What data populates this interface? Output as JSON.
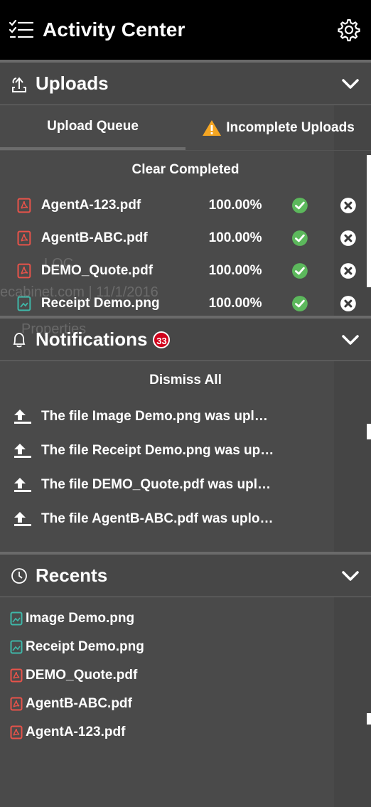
{
  "header": {
    "title": "Activity Center"
  },
  "uploads": {
    "title": "Uploads",
    "tabs": [
      {
        "label": "Upload Queue",
        "active": true
      },
      {
        "label": "Incomplete Uploads",
        "active": false
      }
    ],
    "clear_label": "Clear Completed",
    "items": [
      {
        "name": "AgentA-123.pdf",
        "progress": "100.00%",
        "type": "pdf"
      },
      {
        "name": "AgentB-ABC.pdf",
        "progress": "100.00%",
        "type": "pdf"
      },
      {
        "name": "DEMO_Quote.pdf",
        "progress": "100.00%",
        "type": "pdf"
      },
      {
        "name": "Receipt Demo.png",
        "progress": "100.00%",
        "type": "png"
      }
    ]
  },
  "notifications": {
    "title": "Notifications",
    "count": "33",
    "dismiss_label": "Dismiss All",
    "items": [
      "The file Image Demo.png was upl…",
      "The file Receipt Demo.png was up…",
      "The file DEMO_Quote.pdf was upl…",
      "The file AgentB-ABC.pdf was uplo…"
    ]
  },
  "recents": {
    "title": "Recents",
    "items": [
      {
        "name": "Image Demo.png",
        "type": "png"
      },
      {
        "name": "Receipt Demo.png",
        "type": "png"
      },
      {
        "name": "DEMO_Quote.pdf",
        "type": "pdf"
      },
      {
        "name": "AgentB-ABC.pdf",
        "type": "pdf"
      },
      {
        "name": "AgentA-123.pdf",
        "type": "pdf"
      }
    ]
  },
  "background_text": {
    "line1": "LOC",
    "line2": "ecabinet.com | 11/1/2016",
    "line3": "Properties"
  },
  "colors": {
    "header_bg": "#000000",
    "panel_bg": "#474747",
    "pdf_icon": "#e8534a",
    "png_icon": "#3fb7a8",
    "success": "#5cb85c",
    "badge": "#d0021b",
    "warning": "#f5a623"
  }
}
